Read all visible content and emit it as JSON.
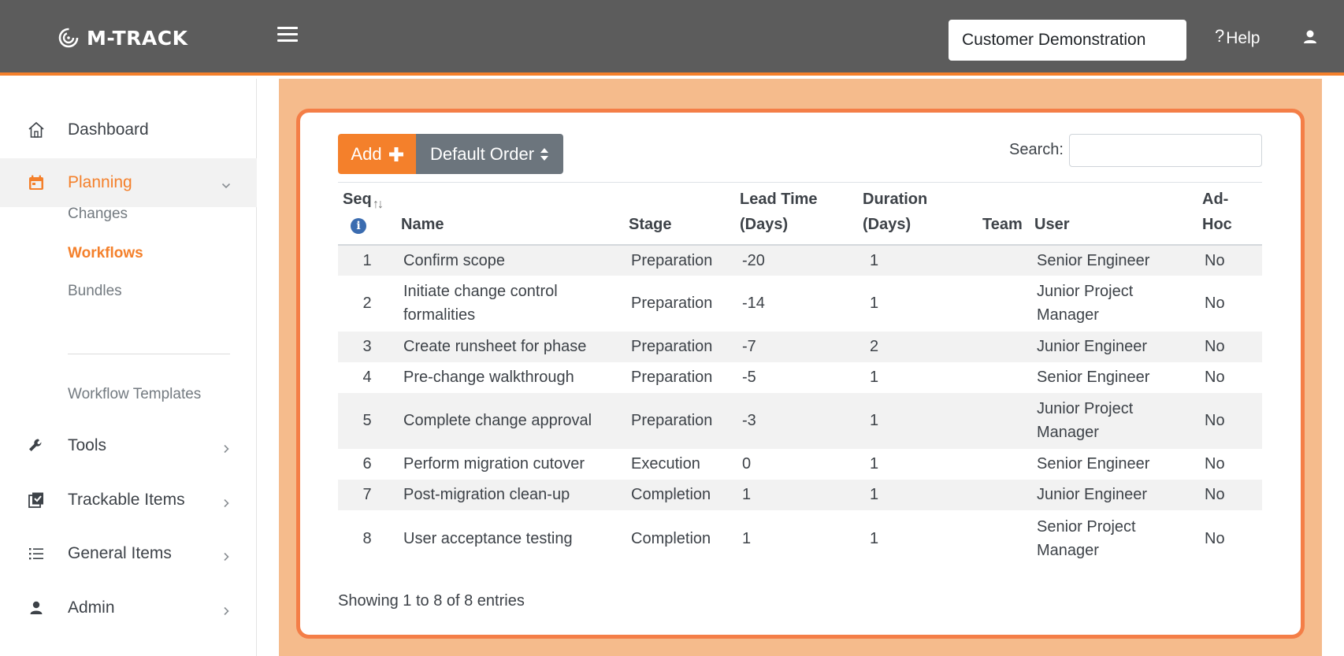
{
  "header": {
    "brand": "M-TRACK",
    "customer": "Customer Demonstration",
    "help_label": "Help",
    "help_mark": "?"
  },
  "sidebar": {
    "items": [
      {
        "label": "Dashboard",
        "icon": "home-icon"
      },
      {
        "label": "Planning",
        "icon": "calendar-icon",
        "active": true
      },
      {
        "label": "Tools",
        "icon": "wrench-icon"
      },
      {
        "label": "Trackable Items",
        "icon": "checklist-icon"
      },
      {
        "label": "General Items",
        "icon": "list-icon"
      },
      {
        "label": "Admin",
        "icon": "user-icon"
      }
    ],
    "planning_sub": [
      {
        "label": "Changes"
      },
      {
        "label": "Workflows",
        "current": true
      },
      {
        "label": "Bundles"
      },
      {
        "label": "Workflow Templates"
      }
    ]
  },
  "toolbar": {
    "add_label": "Add",
    "order_label": "Default Order",
    "search_label": "Search:",
    "search_value": ""
  },
  "table": {
    "headers": {
      "seq": "Seq",
      "name": "Name",
      "stage": "Stage",
      "lead_line1": "Lead Time",
      "lead_line2": "(Days)",
      "duration_line1": "Duration",
      "duration_line2": "(Days)",
      "team": "Team",
      "user": "User",
      "adhoc_line1": "Ad-",
      "adhoc_line2": "Hoc"
    },
    "rows": [
      {
        "seq": "1",
        "name": "Confirm scope",
        "stage": "Preparation",
        "lead": "-20",
        "duration": "1",
        "team": "",
        "user": "Senior Engineer",
        "adhoc": "No"
      },
      {
        "seq": "2",
        "name": "Initiate change control formalities",
        "stage": "Preparation",
        "lead": "-14",
        "duration": "1",
        "team": "",
        "user": "Junior Project Manager",
        "adhoc": "No"
      },
      {
        "seq": "3",
        "name": "Create runsheet for phase",
        "stage": "Preparation",
        "lead": "-7",
        "duration": "2",
        "team": "",
        "user": "Junior Engineer",
        "adhoc": "No"
      },
      {
        "seq": "4",
        "name": "Pre-change walkthrough",
        "stage": "Preparation",
        "lead": "-5",
        "duration": "1",
        "team": "",
        "user": "Senior Engineer",
        "adhoc": "No"
      },
      {
        "seq": "5",
        "name": "Complete change approval",
        "stage": "Preparation",
        "lead": "-3",
        "duration": "1",
        "team": "",
        "user": "Junior Project Manager",
        "adhoc": "No"
      },
      {
        "seq": "6",
        "name": "Perform migration cutover",
        "stage": "Execution",
        "lead": "0",
        "duration": "1",
        "team": "",
        "user": "Senior Engineer",
        "adhoc": "No"
      },
      {
        "seq": "7",
        "name": "Post-migration clean-up",
        "stage": "Completion",
        "lead": "1",
        "duration": "1",
        "team": "",
        "user": "Junior Engineer",
        "adhoc": "No"
      },
      {
        "seq": "8",
        "name": "User acceptance testing",
        "stage": "Completion",
        "lead": "1",
        "duration": "1",
        "team": "",
        "user": "Senior Project Manager",
        "adhoc": "No"
      }
    ]
  },
  "footer": {
    "info": "Showing 1 to 8 of 8 entries"
  },
  "colors": {
    "accent": "#f4802b",
    "header_bg": "#5c5c5c",
    "main_bg": "#f5bb8c",
    "card_border": "#f47e47",
    "secondary_button": "#6c757d"
  }
}
